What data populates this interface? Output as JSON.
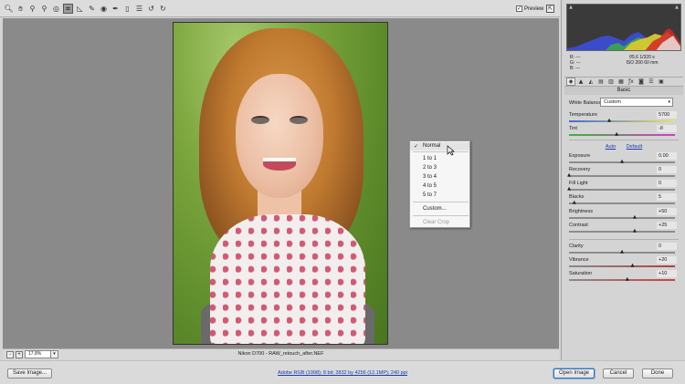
{
  "toolbar": {
    "tools": [
      {
        "name": "zoom-tool",
        "glyph": "🔍︎"
      },
      {
        "name": "hand-tool",
        "glyph": "✋︎"
      },
      {
        "name": "white-balance-tool",
        "glyph": "⚲"
      },
      {
        "name": "color-sampler-tool",
        "glyph": "⚲"
      },
      {
        "name": "targeted-adjustment-tool",
        "glyph": "◎"
      },
      {
        "name": "crop-tool",
        "glyph": "⌗"
      },
      {
        "name": "straighten-tool",
        "glyph": "◺"
      },
      {
        "name": "spot-removal-tool",
        "glyph": "✎"
      },
      {
        "name": "red-eye-tool",
        "glyph": "◉"
      },
      {
        "name": "adjustment-brush-tool",
        "glyph": "✒"
      },
      {
        "name": "graduated-filter-tool",
        "glyph": "▯"
      },
      {
        "name": "preferences-tool",
        "glyph": "☰"
      },
      {
        "name": "rotate-left-tool",
        "glyph": "↺"
      },
      {
        "name": "rotate-right-tool",
        "glyph": "↻"
      }
    ],
    "preview_label": "Preview",
    "preview_checked": "✓",
    "fullscreen_glyph": "⇱"
  },
  "crop_menu": {
    "items": [
      "Normal",
      "1 to 1",
      "2 to 3",
      "3 to 4",
      "4 to 5",
      "5 to 7",
      "Custom...",
      "Clear Crop"
    ],
    "selected": "Normal",
    "check": "✓"
  },
  "status": {
    "zoom_minus": "-",
    "zoom_plus": "+",
    "zoom_value": "17.8%",
    "zoom_drop": "▾",
    "filename": "Nikon D700  -  RAW_retouch_after.NEF"
  },
  "bottom": {
    "save_label": "Save Image...",
    "workflow_label": "Adobe RGB (1998); 8 bit; 2832 by 4256 (12.1MP); 240 ppi",
    "open_label": "Open Image",
    "cancel_label": "Cancel",
    "done_label": "Done"
  },
  "info": {
    "r": "R:   ---",
    "g": "G:   ---",
    "b": "B:   ---",
    "aperture_shutter": "f/5.6    1/320 s",
    "iso_focal": "ISO 200    60 mm"
  },
  "panel_tabs": [
    "◉",
    "▲",
    "◭",
    "▤",
    "▥",
    "▦",
    "ƒx",
    "◙",
    "☰",
    "▣"
  ],
  "panel_title": "Basic",
  "white_balance": {
    "label": "White Balance:",
    "value": "Custom",
    "arrow": "▾"
  },
  "sliders": {
    "temperature": {
      "label": "Temperature",
      "value": "5700",
      "pos": 0.38
    },
    "tint": {
      "label": "Tint",
      "value": "-8",
      "pos": 0.45
    },
    "exposure": {
      "label": "Exposure",
      "value": "0.00",
      "pos": 0.5
    },
    "recovery": {
      "label": "Recovery",
      "value": "0",
      "pos": 0.0
    },
    "fill_light": {
      "label": "Fill Light",
      "value": "0",
      "pos": 0.0
    },
    "blacks": {
      "label": "Blacks",
      "value": "5",
      "pos": 0.05
    },
    "brightness": {
      "label": "Brightness",
      "value": "+50",
      "pos": 0.62
    },
    "contrast": {
      "label": "Contrast",
      "value": "+25",
      "pos": 0.62
    },
    "clarity": {
      "label": "Clarity",
      "value": "0",
      "pos": 0.5
    },
    "vibrance": {
      "label": "Vibrance",
      "value": "+20",
      "pos": 0.6
    },
    "saturation": {
      "label": "Saturation",
      "value": "+10",
      "pos": 0.55
    }
  },
  "links": {
    "auto": "Auto",
    "default": "Default"
  },
  "clip_glyph": "▲",
  "thumb_glyph": "▲"
}
